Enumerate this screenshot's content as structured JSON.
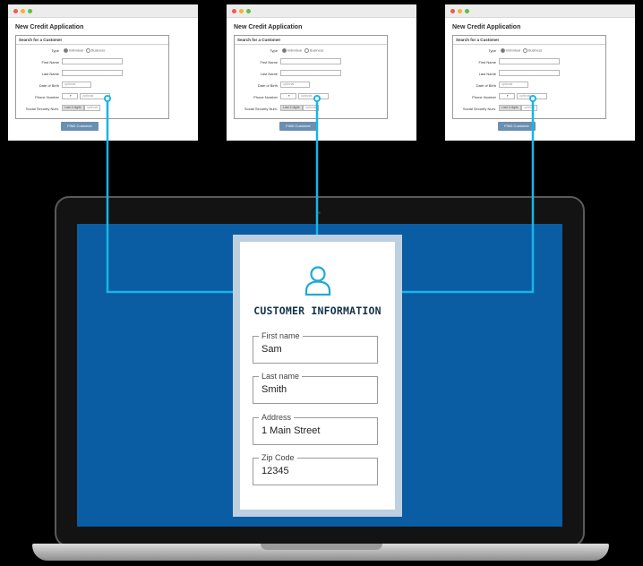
{
  "app_windows": [
    {
      "title": "New Credit Application",
      "panel_title": "Search for a Customer",
      "type_label": "Type",
      "type_options": [
        "Individual",
        "Business"
      ],
      "first_name_label": "First Name",
      "last_name_label": "Last Name",
      "dob_label": "Date of Birth",
      "dob_placeholder": "optional",
      "phone_label": "Phone Number",
      "phone_placeholder": "optional",
      "ssn_label": "Social Security Num.",
      "ssn_tag": "Last 4 digits",
      "ssn_placeholder": "optional",
      "button": "FIND Customer"
    },
    {
      "title": "New Credit Application",
      "panel_title": "Search for a Customer",
      "type_label": "Type",
      "type_options": [
        "Individual",
        "Business"
      ],
      "first_name_label": "First Name",
      "last_name_label": "Last Name",
      "dob_label": "Date of Birth",
      "dob_placeholder": "optional",
      "phone_label": "Phone Number",
      "phone_placeholder": "optional",
      "ssn_label": "Social Security Num.",
      "ssn_tag": "Last 4 digits",
      "ssn_placeholder": "optional",
      "button": "FIND Customer"
    },
    {
      "title": "New Credit Application",
      "panel_title": "Search for a Customer",
      "type_label": "Type",
      "type_options": [
        "Individual",
        "Business"
      ],
      "first_name_label": "First Name",
      "last_name_label": "Last Name",
      "dob_label": "Date of Birth",
      "dob_placeholder": "optional",
      "phone_label": "Phone Number",
      "phone_placeholder": "optional",
      "ssn_label": "Social Security Num.",
      "ssn_tag": "Last 4 digits",
      "ssn_placeholder": "optional",
      "button": "FIND Customer"
    }
  ],
  "customer_card": {
    "icon": "user-icon",
    "title": "CUSTOMER INFORMATION",
    "fields": [
      {
        "label": "First name",
        "value": "Sam"
      },
      {
        "label": "Last name",
        "value": "Smith"
      },
      {
        "label": "Address",
        "value": "1 Main Street"
      },
      {
        "label": "Zip Code",
        "value": "12345"
      }
    ]
  },
  "colors": {
    "background": "#000000",
    "screen": "#0a5ca3",
    "connector": "#19b4e8",
    "card_title": "#15324a",
    "find_button": "#6b8fb0"
  }
}
